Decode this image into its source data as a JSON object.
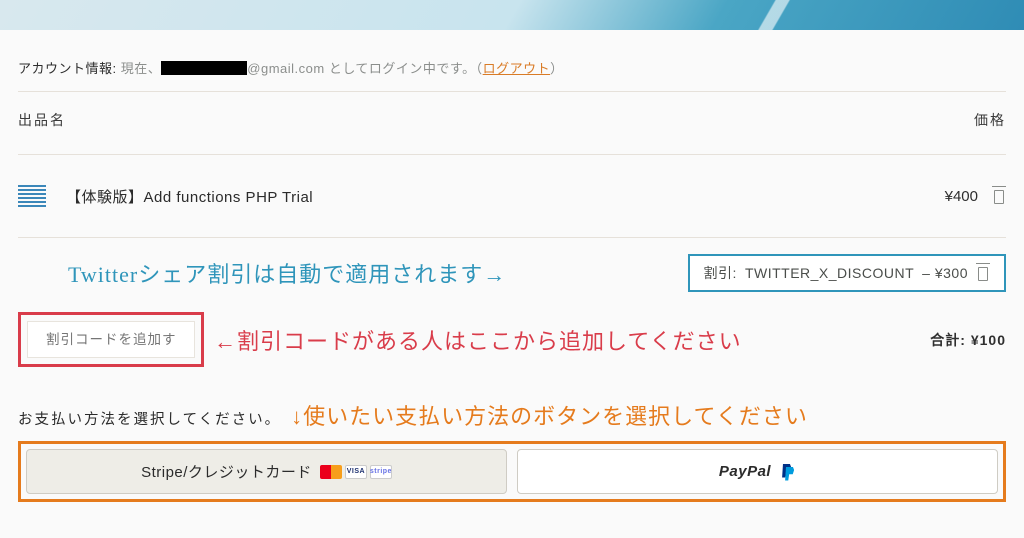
{
  "account": {
    "label": "アカウント情報:",
    "status_prefix": "現在、",
    "email_suffix": "@gmail.com",
    "status_suffix": " としてログイン中です。（",
    "logout": "ログアウト",
    "status_close": "）"
  },
  "columns": {
    "name": "出品名",
    "price": "価格"
  },
  "item": {
    "title": "【体験版】Add functions PHP Trial",
    "price": "¥400"
  },
  "discount_applied": {
    "label": "割引:",
    "code": "TWITTER_X_DISCOUNT",
    "amount": "– ¥300"
  },
  "coupon_input_placeholder": "割引コードを追加する",
  "total": {
    "label": "合計:",
    "value": "¥100"
  },
  "pay_heading": "お支払い方法を選択してください。",
  "annotations": {
    "twitter_share": "Twitterシェア割引は自動で適用されます→",
    "coupon_hint": "←割引コードがある人はここから追加してください",
    "pay_hint": "↓使いたい支払い方法のボタンを選択してください"
  },
  "payment": {
    "stripe_label": "Stripe/クレジットカード",
    "paypal_label": "PayPal"
  }
}
